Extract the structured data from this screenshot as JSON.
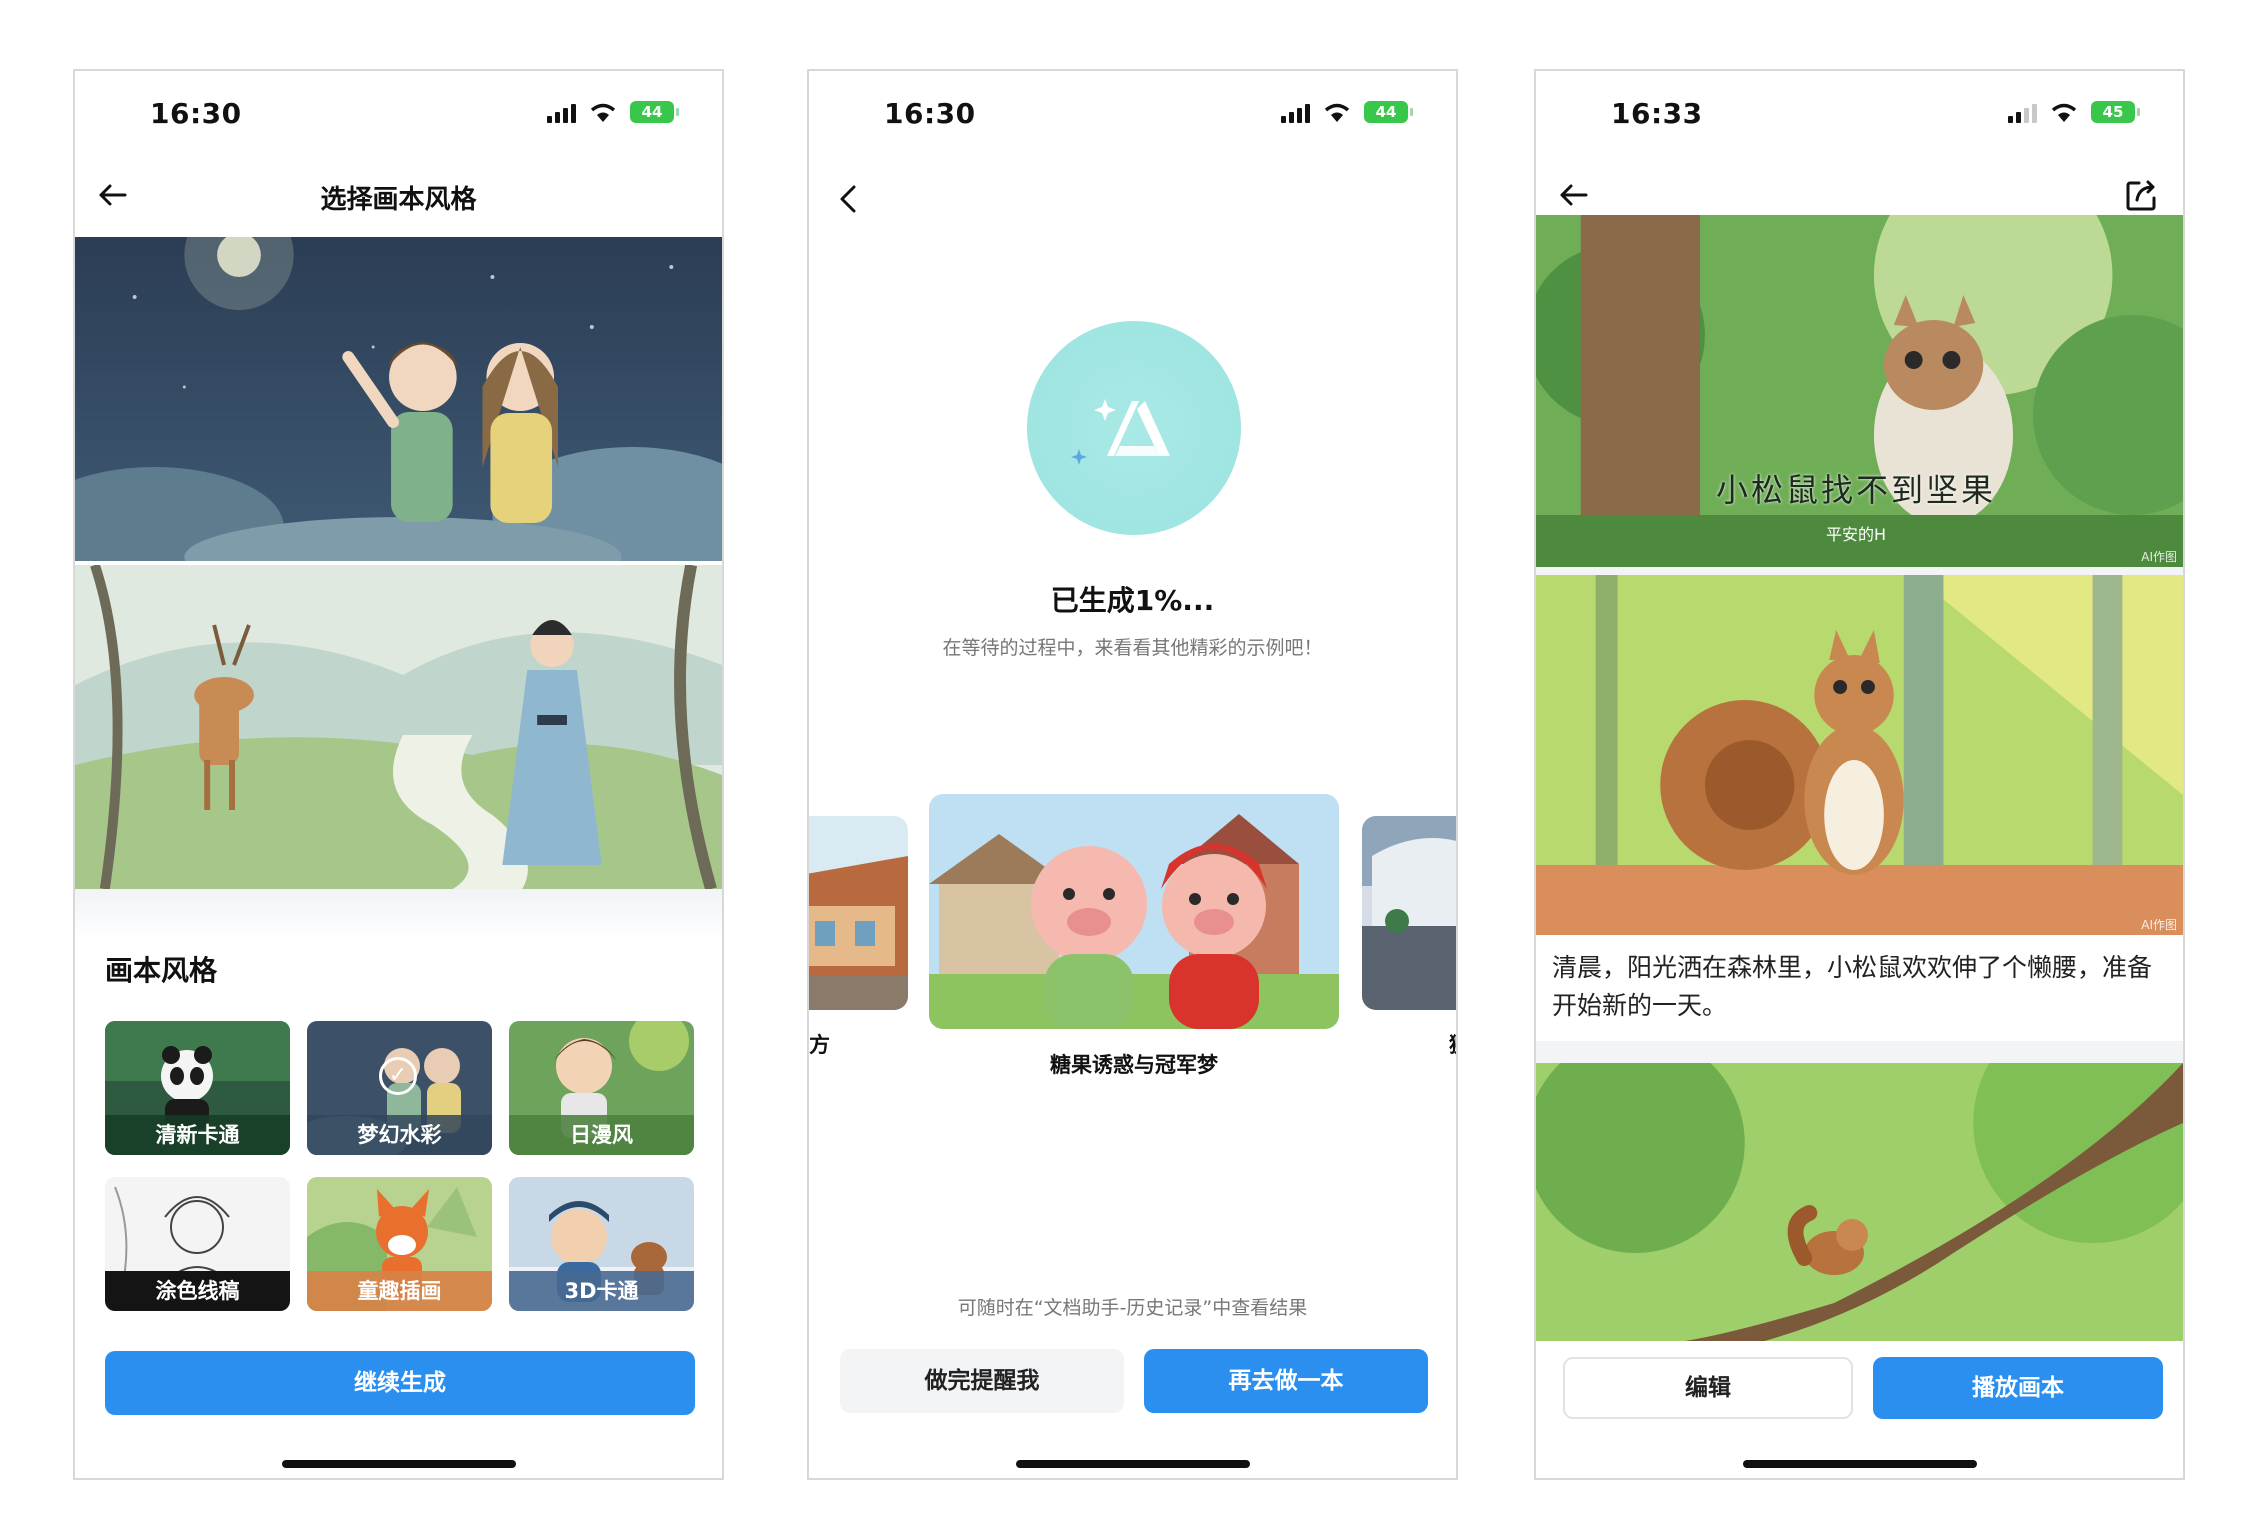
{
  "colors": {
    "primary": "#2b8ff0",
    "battery": "#38c74a",
    "ai_logo": "#a9e9e6"
  },
  "screen1": {
    "time": "16:30",
    "battery": "44",
    "title": "选择画本风格",
    "section_title": "画本风格",
    "styles": [
      {
        "label": "清新卡通",
        "selected": false
      },
      {
        "label": "梦幻水彩",
        "selected": true
      },
      {
        "label": "日漫风",
        "selected": false
      },
      {
        "label": "涂色线稿",
        "selected": false
      },
      {
        "label": "童趣插画",
        "selected": false
      },
      {
        "label": "3D卡通",
        "selected": false
      }
    ],
    "continue_button": "继续生成"
  },
  "screen2": {
    "time": "16:30",
    "battery": "44",
    "progress_title": "已生成1%...",
    "progress_subtitle": "在等待的过程中，来看看其他精彩的示例吧！",
    "carousel_caption": "糖果诱惑与冠军梦",
    "carousel_left_caption": "方",
    "carousel_right_caption": "狮",
    "hint": "可随时在“文档助手-历史记录”中查看结果",
    "remind_button": "做完提醒我",
    "again_button": "再去做一本"
  },
  "screen3": {
    "time": "16:33",
    "battery": "45",
    "cover_title": "小松鼠找不到坚果",
    "cover_subtitle": "平安的H",
    "ai_tag": "AI作图",
    "story_text": "清晨，阳光洒在森林里，小松鼠欢欢伸了个懒腰，准备开始新的一天。",
    "edit_button": "编辑",
    "play_button": "播放画本"
  }
}
